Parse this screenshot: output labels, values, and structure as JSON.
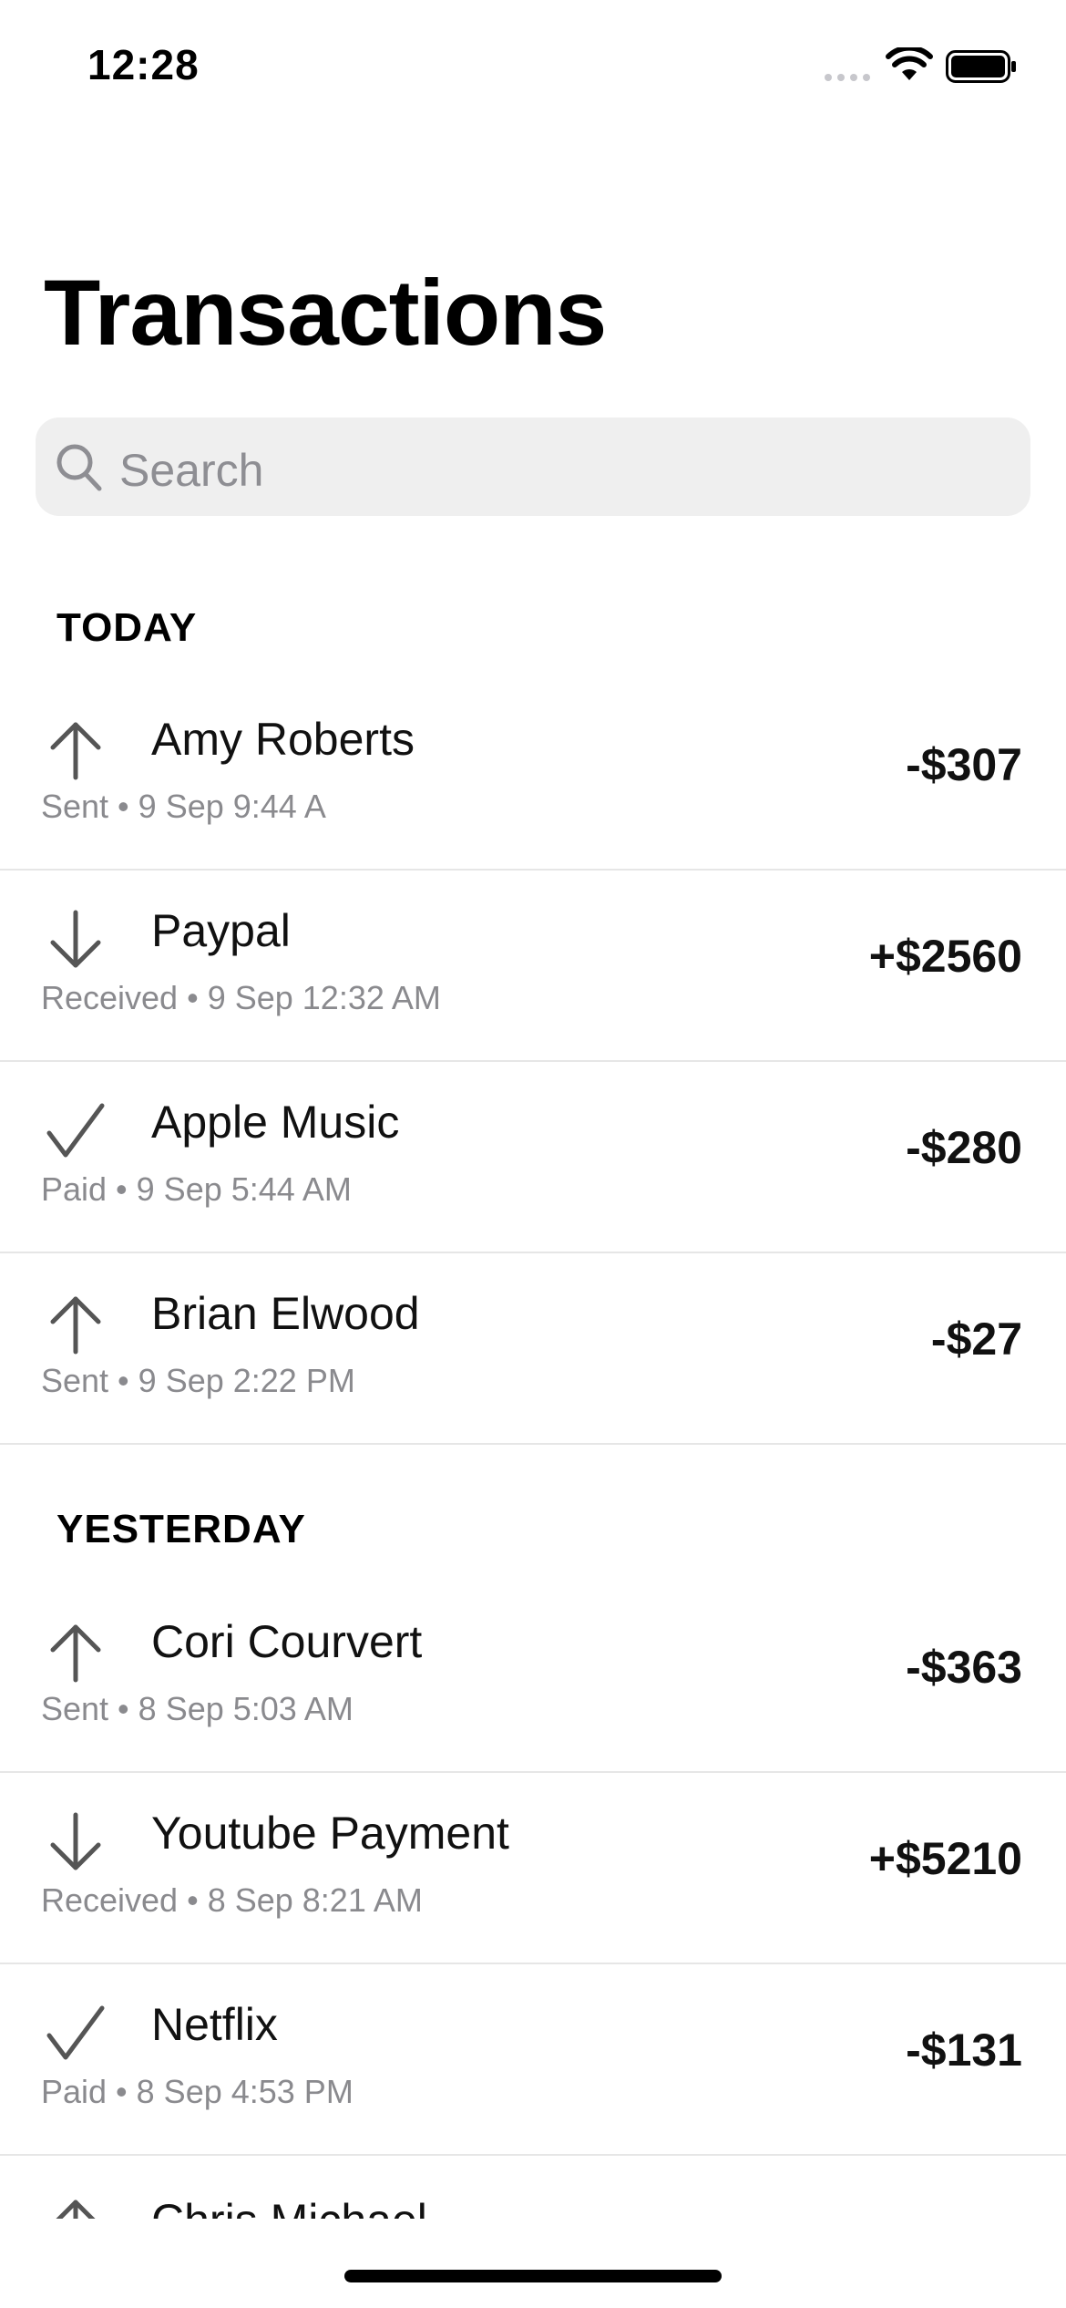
{
  "status_bar": {
    "time": "12:28"
  },
  "header": {
    "title": "Transactions"
  },
  "search": {
    "placeholder": "Search"
  },
  "sections": [
    {
      "header": "TODAY",
      "items": [
        {
          "name": "Amy Roberts",
          "subtitle": "Sent • 9 Sep 9:44 A",
          "amount": "-$307",
          "icon": "arrow-up-icon"
        },
        {
          "name": "Paypal",
          "subtitle": "Received • 9 Sep 12:32 AM",
          "amount": "+$2560",
          "icon": "arrow-down-icon"
        },
        {
          "name": "Apple Music",
          "subtitle": "Paid • 9 Sep 5:44 AM",
          "amount": "-$280",
          "icon": "checkmark-icon"
        },
        {
          "name": "Brian Elwood",
          "subtitle": "Sent • 9 Sep 2:22 PM",
          "amount": "-$27",
          "icon": "arrow-up-icon"
        }
      ]
    },
    {
      "header": "YESTERDAY",
      "items": [
        {
          "name": "Cori Courvert",
          "subtitle": "Sent • 8 Sep 5:03 AM",
          "amount": "-$363",
          "icon": "arrow-up-icon"
        },
        {
          "name": "Youtube Payment",
          "subtitle": "Received • 8 Sep 8:21 AM",
          "amount": "+$5210",
          "icon": "arrow-down-icon"
        },
        {
          "name": "Netflix",
          "subtitle": "Paid • 8 Sep 4:53 PM",
          "amount": "-$131",
          "icon": "checkmark-icon"
        },
        {
          "name": "Chris Michael",
          "icon": "arrow-up-icon"
        }
      ]
    }
  ],
  "colors": {
    "icon_stroke": "#555555",
    "secondary_text": "#8a8a8e",
    "search_background": "#efefef",
    "divider": "#e6e6e6"
  }
}
